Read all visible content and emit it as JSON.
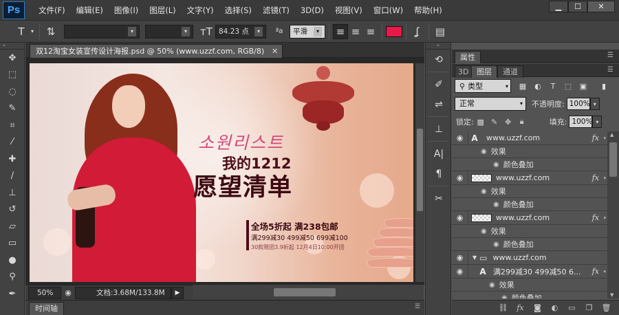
{
  "app": {
    "logo": "Ps",
    "menu": [
      "文件(F)",
      "编辑(E)",
      "图像(I)",
      "图层(L)",
      "文字(Y)",
      "选择(S)",
      "滤镜(T)",
      "3D(D)",
      "视图(V)",
      "窗口(W)",
      "帮助(H)"
    ],
    "window_controls": [
      "minimize-icon",
      "maximize-icon",
      "close-icon"
    ]
  },
  "options_bar": {
    "font_size": "84.23 点",
    "antialias_label": "ªa",
    "antialias": "平滑",
    "text_color": "#e8194a"
  },
  "document": {
    "tab_title": "双12淘宝女装宣传设计海报.psd @ 50% (www.uzzf.com, RGB/8)",
    "zoom": "50%",
    "doc_info": "文档:3.68M/133.8M"
  },
  "poster": {
    "korean": "소원리스트",
    "title_line1": "我的1212",
    "title_line2": "愿望清单",
    "promo1": "全场5折起  满238包邮",
    "promo2": "满299减30  499减50  699减100",
    "promo3": "30款限团3.9折起  12月4日10:00开团"
  },
  "timeline": {
    "label": "时间轴"
  },
  "panels": {
    "properties_tab": "属性",
    "layers_tabs": [
      "3D",
      "图层",
      "通道"
    ],
    "filter_kind": "类型",
    "blend_mode": "正常",
    "opacity_label": "不透明度:",
    "opacity": "100%",
    "lock_label": "锁定:",
    "fill_label": "填充:",
    "fill": "100%"
  },
  "layers": [
    {
      "kind": "text",
      "name": "www.uzzf.com",
      "fx": "fx",
      "effect_label": "效果",
      "effect_item": "颜色叠加"
    },
    {
      "kind": "shape",
      "name": "www.uzzf.com",
      "fx": "fx",
      "effect_label": "效果",
      "effect_item": "颜色叠加"
    },
    {
      "kind": "shape",
      "name": "www.uzzf.com",
      "fx": "fx",
      "effect_label": "效果",
      "effect_item": "颜色叠加"
    },
    {
      "kind": "group",
      "name": "www.uzzf.com"
    },
    {
      "kind": "text",
      "name": "满299减30  499减50  6...",
      "fx": "fx",
      "effect_label": "效果",
      "effect_item": "颜色叠加"
    }
  ],
  "colors": {
    "ui_bg": "#535353",
    "menubar_bg": "#3a3a3a",
    "accent_red": "#e8194a",
    "ps_blue": "#2c7fc9"
  }
}
